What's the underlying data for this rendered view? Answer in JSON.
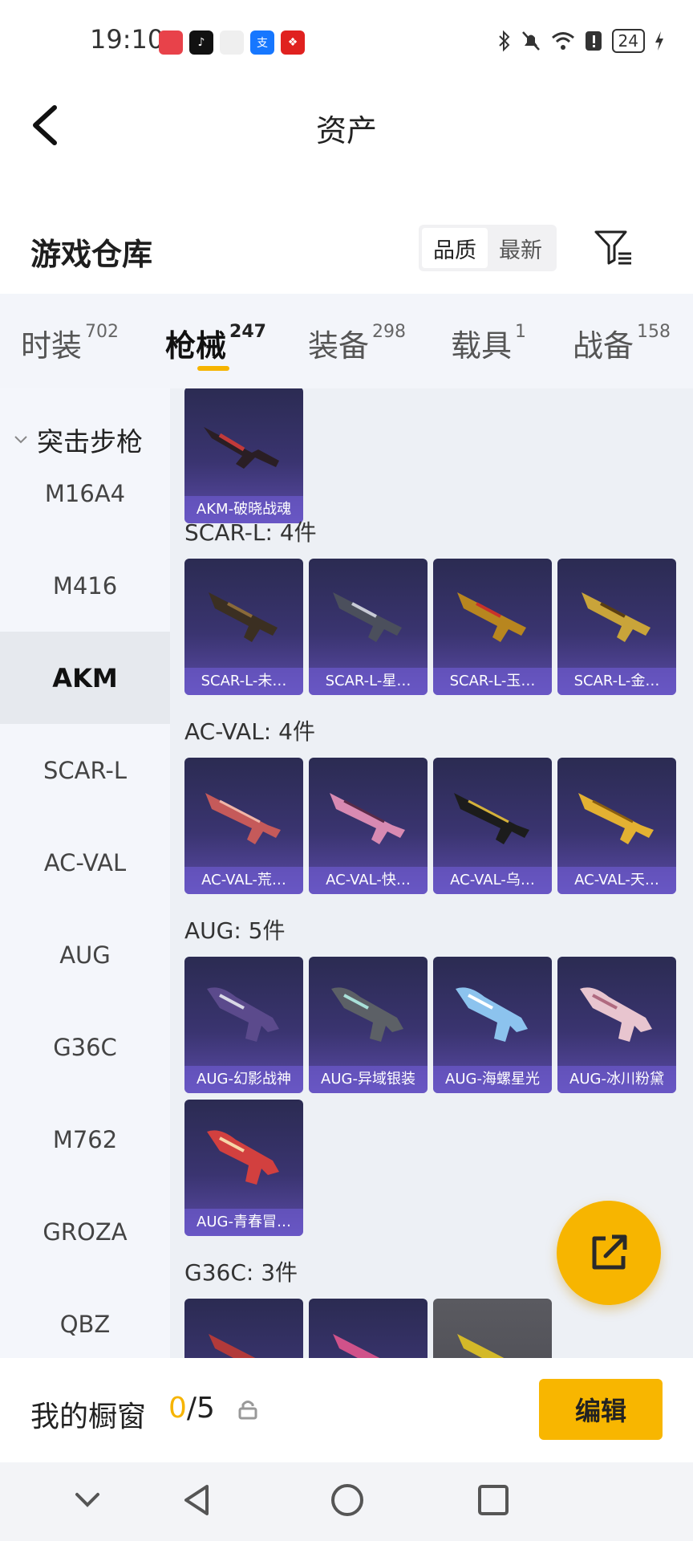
{
  "status_bar": {
    "time": "19:10",
    "apps": [
      {
        "icon": "huawei-app-icon",
        "color": "#e8424a"
      },
      {
        "icon": "tiktok-icon",
        "color": "#111111"
      },
      {
        "icon": "gift-box-icon",
        "color": "#f1f1f1"
      },
      {
        "icon": "alipay-icon",
        "color": "#1677ff"
      },
      {
        "icon": "red-app-icon",
        "color": "#e0211f"
      }
    ],
    "battery": "24"
  },
  "header": {
    "title": "资产"
  },
  "repo": {
    "title": "游戏仓库",
    "sort_options": [
      "品质",
      "最新"
    ]
  },
  "tabs": [
    {
      "label": "时装",
      "count": "702"
    },
    {
      "label": "枪械",
      "count": "247"
    },
    {
      "label": "装备",
      "count": "298"
    },
    {
      "label": "载具",
      "count": "1"
    },
    {
      "label": "战备",
      "count": "158"
    }
  ],
  "sidebar": {
    "category": "突击步枪",
    "items": [
      "M16A4",
      "M416",
      "AKM",
      "SCAR-L",
      "AC-VAL",
      "AUG",
      "G36C",
      "M762",
      "GROZA",
      "QBZ"
    ]
  },
  "groups": {
    "akm": {
      "items": [
        "AKM-破晓战魂"
      ]
    },
    "scar": {
      "label": "SCAR-L: 4件",
      "items": [
        "SCAR-L-未…",
        "SCAR-L-星…",
        "SCAR-L-玉…",
        "SCAR-L-金…"
      ]
    },
    "acval": {
      "label": "AC-VAL: 4件",
      "items": [
        "AC-VAL-荒…",
        "AC-VAL-快…",
        "AC-VAL-乌…",
        "AC-VAL-天…"
      ]
    },
    "aug": {
      "label": "AUG: 5件",
      "items": [
        "AUG-幻影战神",
        "AUG-异域银装",
        "AUG-海螺星光",
        "AUG-冰川粉黛",
        "AUG-青春冒…"
      ]
    },
    "g36c": {
      "label": "G36C: 3件"
    }
  },
  "showcase": {
    "label": "我的橱窗",
    "current": "0",
    "total": "/5",
    "edit_label": "编辑"
  },
  "colors": {
    "accent": "#f6b400",
    "card_purple": "#3a3470"
  }
}
